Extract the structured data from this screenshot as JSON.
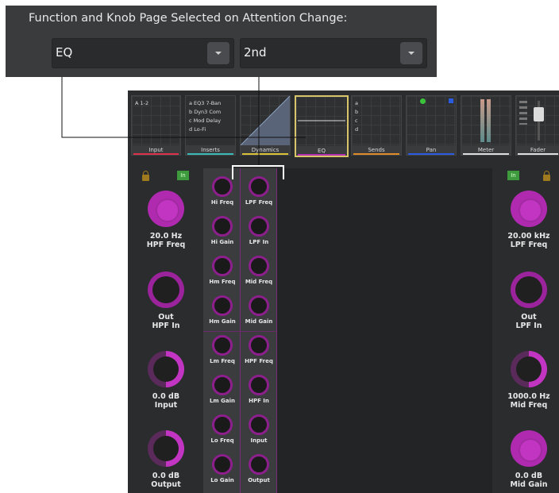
{
  "settings": {
    "title": "Function and Knob Page Selected on Attention Change:",
    "function_value": "EQ",
    "knob_page_value": "2nd"
  },
  "strips": [
    {
      "label": "Input",
      "content": "A 1-2",
      "color": "#d9324a"
    },
    {
      "label": "Inserts",
      "content": "a EQ3 7-Ban\nb Dyn3 Com\nc Mod Delay\nd Lo-Fi",
      "color": "#3ab9b9"
    },
    {
      "label": "Dynamics",
      "content": "",
      "color": "#d9c23a"
    },
    {
      "label": "EQ",
      "content": "",
      "color": "#b230b2"
    },
    {
      "label": "Sends",
      "content": "a\nb\nc\nd",
      "color": "#e08b2a"
    },
    {
      "label": "Pan",
      "content": "",
      "color": "#2a5be0"
    },
    {
      "label": "Meter",
      "content": "",
      "color": "#dddddd"
    },
    {
      "label": "Fader",
      "content": "",
      "color": "#dddddd"
    }
  ],
  "in_label": "In",
  "left_knobs": [
    {
      "value": "20.0 Hz",
      "name": "HPF Freq"
    },
    {
      "value": "Out",
      "name": "HPF In"
    },
    {
      "value": "0.0 dB",
      "name": "Input"
    },
    {
      "value": "0.0 dB",
      "name": "Output"
    }
  ],
  "right_knobs": [
    {
      "value": "20.00 kHz",
      "name": "LPF Freq"
    },
    {
      "value": "Out",
      "name": "LPF In"
    },
    {
      "value": "1000.0 Hz",
      "name": "Mid Freq"
    },
    {
      "value": "0.0 dB",
      "name": "Mid Gain"
    }
  ],
  "grid_col1": [
    "Hi Freq",
    "Hi Gain",
    "Hm Freq",
    "Hm Gain",
    "Lm Freq",
    "Lm Gain",
    "Lo Freq",
    "Lo Gain"
  ],
  "grid_col2": [
    "LPF Freq",
    "LPF In",
    "Mid Freq",
    "Mid Gain",
    "HPF Freq",
    "HPF In",
    "Input",
    "Output"
  ],
  "colors": {
    "accent": "#b02ab0",
    "panel": "#2b2c2e",
    "dark": "#3a3b3d"
  }
}
